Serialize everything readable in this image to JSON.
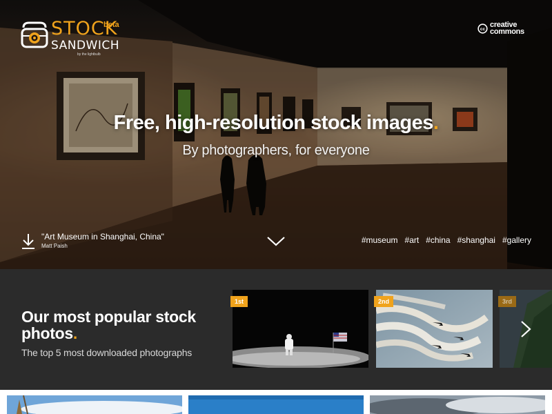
{
  "brand": {
    "name_top": "STOCK",
    "name_bottom": "SANDWICH",
    "beta": "beta",
    "by_line": "by the lightbulb"
  },
  "license": {
    "line1": "creative",
    "line2": "commons"
  },
  "hero": {
    "title": "Free, high-resolution stock images",
    "title_dot": ".",
    "subtitle": "By photographers, for everyone",
    "photo_title": "\"Art Museum in Shanghai, China\"",
    "photo_author": "Matt Paish",
    "tags": [
      "#museum",
      "#art",
      "#china",
      "#shanghai",
      "#gallery"
    ]
  },
  "popular": {
    "heading": "Our most popular stock photos",
    "heading_dot": ".",
    "subheading": "The top 5 most downloaded photographs",
    "ranks": [
      "1st",
      "2nd",
      "3rd"
    ]
  },
  "icons": {
    "camera": "camera-logo-icon",
    "cc": "creative-commons-icon",
    "download": "download-icon",
    "scroll": "chevron-down-icon",
    "next": "chevron-right-icon"
  },
  "colors": {
    "accent": "#f0a31c",
    "panel": "#2b2b2b"
  }
}
